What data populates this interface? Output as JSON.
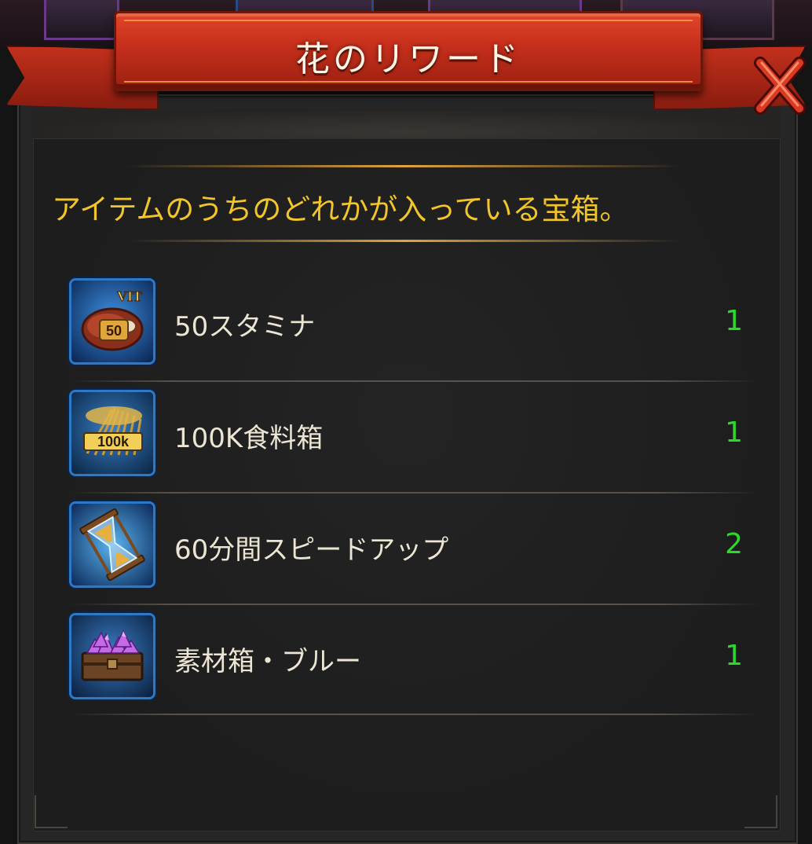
{
  "header": {
    "title": "花のリワード",
    "close_icon": "close-x-icon"
  },
  "description": "アイテムのうちのどれかが入っている宝箱。",
  "rewards": [
    {
      "name": "50スタミナ",
      "quantity": "1",
      "icon": "stamina-meat-icon",
      "icon_badge": "50",
      "icon_tag": "VIT"
    },
    {
      "name": "100K食料箱",
      "quantity": "1",
      "icon": "food-wheat-icon",
      "icon_badge": "100k"
    },
    {
      "name": "60分間スピードアップ",
      "quantity": "2",
      "icon": "hourglass-speedup-icon"
    },
    {
      "name": "素材箱・ブルー",
      "quantity": "1",
      "icon": "material-chest-icon"
    }
  ],
  "colors": {
    "title_text": "#fff5e6",
    "description_text": "#f2c52a",
    "item_name_text": "#ece5d4",
    "quantity_text": "#2dd82d",
    "banner_red": "#c8301c",
    "icon_border_blue": "#2f78c4"
  }
}
